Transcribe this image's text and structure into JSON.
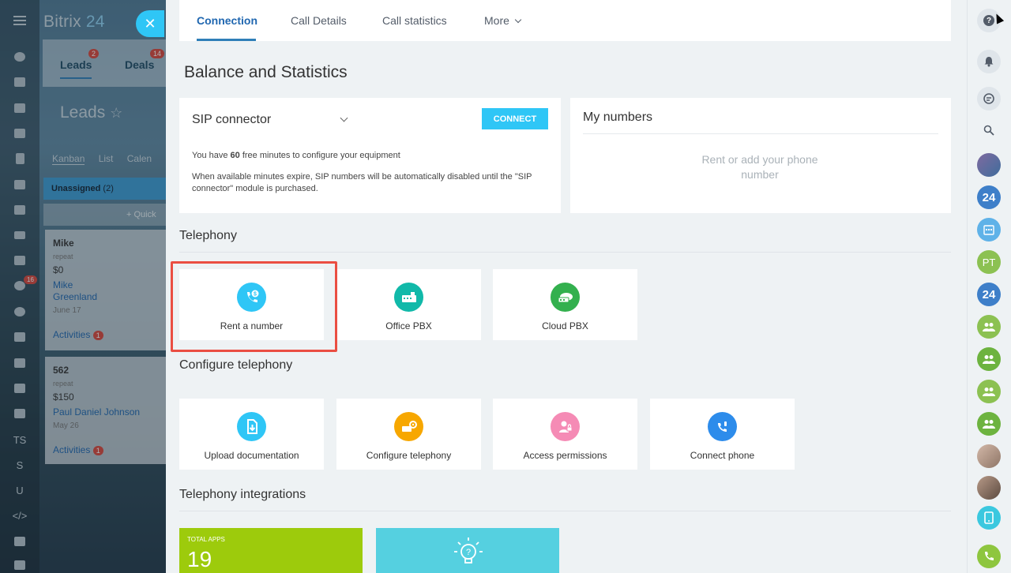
{
  "bg": {
    "logo_main": "Bitrix",
    "logo_num": "24",
    "close_symbol": "✕",
    "tabs": [
      {
        "label": "Leads",
        "badge": "2"
      },
      {
        "label": "Deals",
        "badge": "14"
      }
    ],
    "leads_title": "Leads",
    "star_symbol": "☆",
    "views": [
      "Kanban",
      "List",
      "Calen"
    ],
    "column_name": "Unassigned",
    "column_count": "(2)",
    "quick_label": "+ Quick",
    "iconbar_badge": "16",
    "iconbar_letters": [
      "TS",
      "S",
      "U",
      "</>"
    ],
    "cards": [
      {
        "name": "Mike",
        "sub": "repeat",
        "amount": "$0",
        "contact1": "Mike",
        "contact2": "Greenland",
        "date": "June 17",
        "activities": "Activities",
        "act_badge": "1"
      },
      {
        "name": "562",
        "sub": "repeat",
        "amount": "$150",
        "contact1": "Paul Daniel Johnson",
        "date": "May 26",
        "activities": "Activities",
        "act_badge": "1"
      }
    ]
  },
  "panel": {
    "tabs": [
      "Connection",
      "Call Details",
      "Call statistics",
      "More"
    ],
    "title": "Balance and Statistics",
    "sip": {
      "title": "SIP connector",
      "connect_label": "CONNECT",
      "text1_prefix": "You have ",
      "text1_bold": "60",
      "text1_suffix": " free minutes to configure your equipment",
      "text2": "When available minutes expire, SIP numbers will be automatically disabled until the \"SIP connector\" module is purchased."
    },
    "mynumbers": {
      "title": "My numbers",
      "empty": "Rent or add your phone number"
    },
    "telephony": {
      "title": "Telephony",
      "tiles": [
        "Rent a number",
        "Office PBX",
        "Cloud PBX"
      ]
    },
    "configure": {
      "title": "Configure telephony",
      "tiles": [
        "Upload documentation",
        "Configure telephony",
        "Access permissions",
        "Connect phone"
      ]
    },
    "integrations": {
      "title": "Telephony integrations",
      "apps_label": "TOTAL APPS",
      "apps_count": "19"
    }
  },
  "rail": {
    "help": "?",
    "avatar_initials": "PT",
    "b24": "24"
  },
  "colors": {
    "accent": "#2fc6f6",
    "link": "#2067b0",
    "highlight": "#ea4e42"
  }
}
